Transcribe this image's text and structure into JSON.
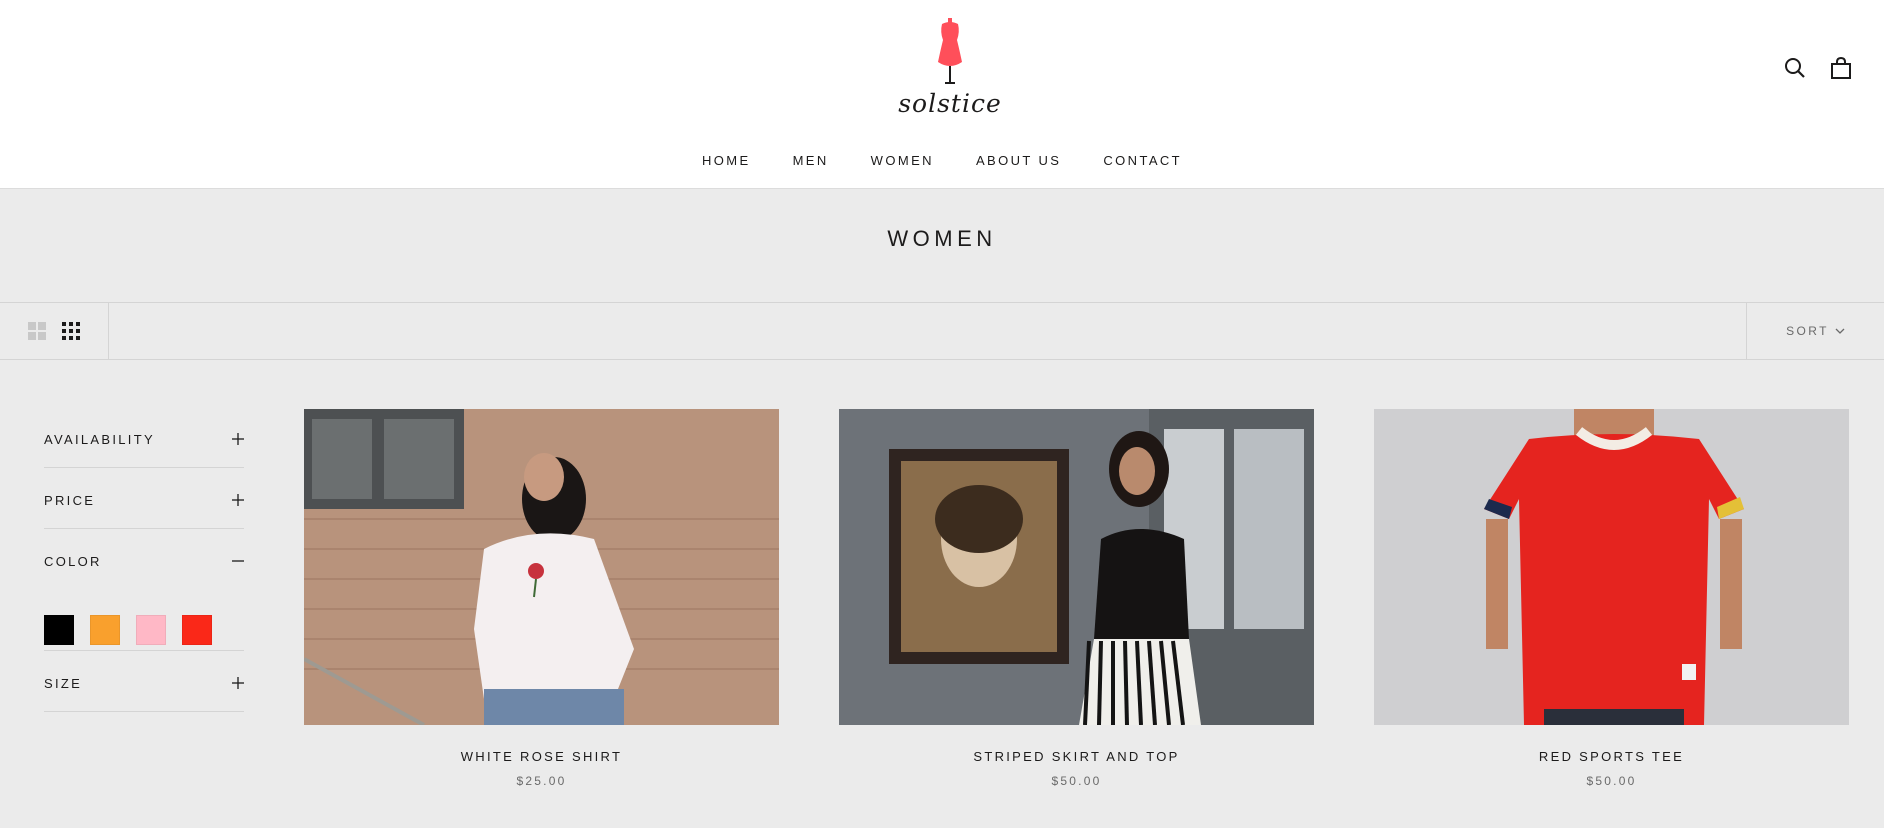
{
  "brand": {
    "name": "solstice",
    "logo_color": "#ff4f5a"
  },
  "header": {
    "icons": [
      "search-icon",
      "cart-icon"
    ],
    "nav": [
      "HOME",
      "MEN",
      "WOMEN",
      "ABOUT US",
      "CONTACT"
    ]
  },
  "collection": {
    "title": "WOMEN"
  },
  "toolbar": {
    "layout_icons": [
      "grid-large-icon",
      "grid-small-icon"
    ],
    "sort_label": "SORT"
  },
  "filters": {
    "groups": [
      {
        "label": "AVAILABILITY",
        "state": "collapsed"
      },
      {
        "label": "PRICE",
        "state": "collapsed"
      },
      {
        "label": "COLOR",
        "state": "expanded"
      },
      {
        "label": "SIZE",
        "state": "collapsed"
      }
    ],
    "color_swatches": [
      {
        "name": "Black",
        "color": "#000000"
      },
      {
        "name": "Orange",
        "color": "#f9a02d"
      },
      {
        "name": "Pink",
        "color": "#ffb8c6"
      },
      {
        "name": "Red",
        "color": "#fa2818"
      }
    ]
  },
  "products": [
    {
      "title": "WHITE ROSE SHIRT",
      "price": "$25.00"
    },
    {
      "title": "STRIPED SKIRT AND TOP",
      "price": "$50.00"
    },
    {
      "title": "RED SPORTS TEE",
      "price": "$50.00"
    }
  ]
}
